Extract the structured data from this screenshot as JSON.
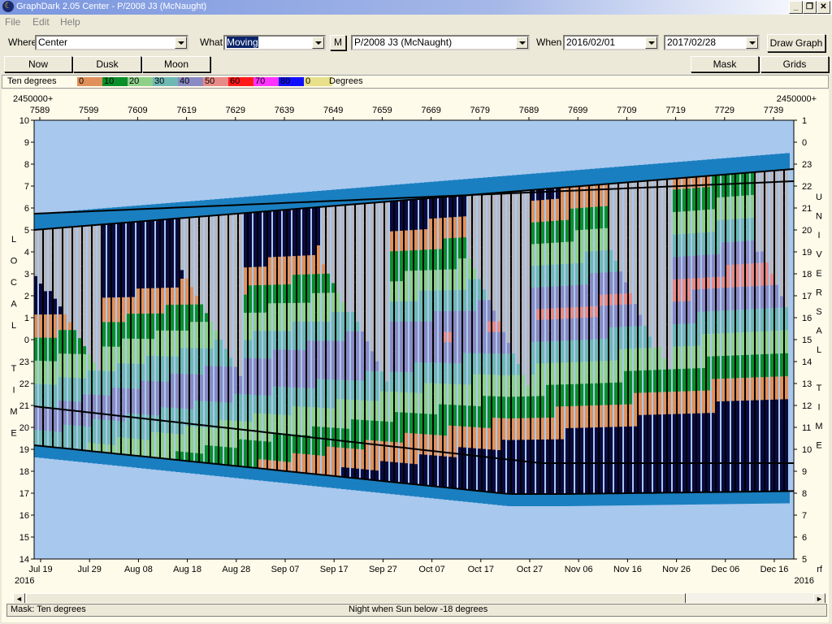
{
  "window": {
    "title": "GraphDark 2.05  Center  -  P/2008 J3 (McNaught)",
    "icon": "app-icon",
    "min": "_",
    "restore": "❐",
    "close": "✕"
  },
  "menu": {
    "file": "File",
    "edit": "Edit",
    "help": "Help"
  },
  "toolbar": {
    "where_label": "Where",
    "where_value": "Center",
    "what_label": "What",
    "what_value": "Moving",
    "m_button": "M",
    "object_value": "P/2008 J3 (McNaught)",
    "when_label": "When",
    "start_date": "2016/02/01",
    "end_date": "2017/02/28",
    "draw_button": "Draw Graph"
  },
  "buttons": {
    "now": "Now",
    "dusk": "Dusk",
    "moon": "Moon",
    "mask": "Mask",
    "grids": "Grids"
  },
  "legend": {
    "label": "Ten degrees",
    "units": "Degrees",
    "swatches": [
      {
        "text": "0",
        "color": "#e0905a"
      },
      {
        "text": "10",
        "color": "#0a8f2a"
      },
      {
        "text": "20",
        "color": "#8ed08a"
      },
      {
        "text": "30",
        "color": "#6fb8b4"
      },
      {
        "text": "40",
        "color": "#8a8ac4"
      },
      {
        "text": "50",
        "color": "#e88a88"
      },
      {
        "text": "60",
        "color": "#ff1a1a"
      },
      {
        "text": "70",
        "color": "#ff33ff"
      },
      {
        "text": "80",
        "color": "#1010ff"
      },
      {
        "text": "0",
        "color": "#e8e08a"
      }
    ]
  },
  "graph": {
    "jd_prefix_left": "2450000+",
    "jd_prefix_right": "2450000+",
    "jd_ticks": [
      "7589",
      "7599",
      "7609",
      "7619",
      "7629",
      "7639",
      "7649",
      "7659",
      "7669",
      "7679",
      "7689",
      "7699",
      "7709",
      "7719",
      "7729",
      "7739"
    ],
    "date_ticks": [
      "Jul 19",
      "Jul 29",
      "Aug 08",
      "Aug 18",
      "Aug 28",
      "Sep 07",
      "Sep 17",
      "Sep 27",
      "Oct 07",
      "Oct 17",
      "Oct 27",
      "Nov 06",
      "Nov 16",
      "Nov 26",
      "Dec 06",
      "Dec 16"
    ],
    "year_left": "2016",
    "year_right": "2016",
    "corner_right": "rf",
    "local_ticks": [
      "10",
      "9",
      "8",
      "7",
      "6",
      "5",
      "4",
      "3",
      "2",
      "1",
      "0",
      "23",
      "22",
      "21",
      "20",
      "19",
      "18",
      "17",
      "16",
      "15",
      "14"
    ],
    "ut_ticks": [
      "1",
      "0",
      "23",
      "22",
      "21",
      "20",
      "19",
      "18",
      "17",
      "16",
      "15",
      "14",
      "13",
      "12",
      "11",
      "10",
      "9",
      "8",
      "7",
      "6",
      "5"
    ],
    "left_vertical_label": [
      "L",
      "O",
      "C",
      "A",
      "L",
      "",
      "T",
      "I",
      "M",
      "E"
    ],
    "right_vertical_label": [
      "U",
      "N",
      "I",
      "V",
      "E",
      "R",
      "S",
      "A",
      "L",
      "",
      "T",
      "I",
      "M",
      "E"
    ]
  },
  "status": {
    "left": "Mask:  Ten degrees",
    "center": "Night when Sun below -18 degrees"
  },
  "colors": {
    "day": "#a8c8ee",
    "twilight": "#1a7fc0",
    "night_dark": "#0a0a40",
    "moon_gray": "#b8b8c0",
    "accent": "#0a246a"
  }
}
